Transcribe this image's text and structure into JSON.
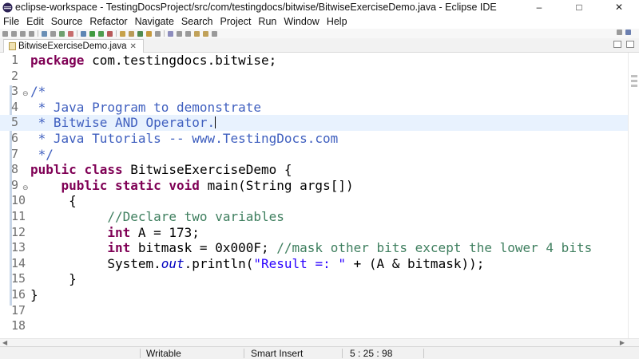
{
  "window": {
    "title": "eclipse-workspace - TestingDocsProject/src/com/testingdocs/bitwise/BitwiseExerciseDemo.java - Eclipse IDE",
    "controls": [
      "–",
      "□",
      "✕"
    ]
  },
  "menu": [
    "File",
    "Edit",
    "Source",
    "Refactor",
    "Navigate",
    "Search",
    "Project",
    "Run",
    "Window",
    "Help"
  ],
  "editor_tab": {
    "label": "BitwiseExerciseDemo.java",
    "close": "✕",
    "icon": "java-file-icon"
  },
  "code_lines": [
    {
      "n": "1",
      "code": "package com.testingdocs.bitwise;"
    },
    {
      "n": "2",
      "code": ""
    },
    {
      "n": "3",
      "code": "/*"
    },
    {
      "n": "4",
      "code": " * Java Program to demonstrate"
    },
    {
      "n": "5",
      "code": " * Bitwise AND Operator."
    },
    {
      "n": "6",
      "code": " * Java Tutorials -- www.TestingDocs.com"
    },
    {
      "n": "7",
      "code": " */"
    },
    {
      "n": "8",
      "code": "public class BitwiseExerciseDemo {"
    },
    {
      "n": "9",
      "code": "    public static void main(String args[])"
    },
    {
      "n": "10",
      "code": "     {"
    },
    {
      "n": "11",
      "code": "          //Declare two variables"
    },
    {
      "n": "12",
      "code": "          int A = 173;"
    },
    {
      "n": "13",
      "code": "          int bitmask = 0x000F; //mask other bits except the lower 4 bits"
    },
    {
      "n": "14",
      "code": "          System.out.println(\"Result =: \" + (A & bitmask));"
    },
    {
      "n": "15",
      "code": "     }"
    },
    {
      "n": "16",
      "code": "}"
    },
    {
      "n": "17",
      "code": ""
    },
    {
      "n": "18",
      "code": ""
    }
  ],
  "current_line": 5,
  "colors": {
    "keyword": "#7f0055",
    "comment": "#3f7f5f",
    "string": "#2a00ff",
    "static_field": "#0000c0",
    "current_line_bg": "#e8f2fe"
  },
  "status": {
    "mode": "Writable",
    "insert": "Smart Insert",
    "position": "5 : 25 : 98"
  }
}
